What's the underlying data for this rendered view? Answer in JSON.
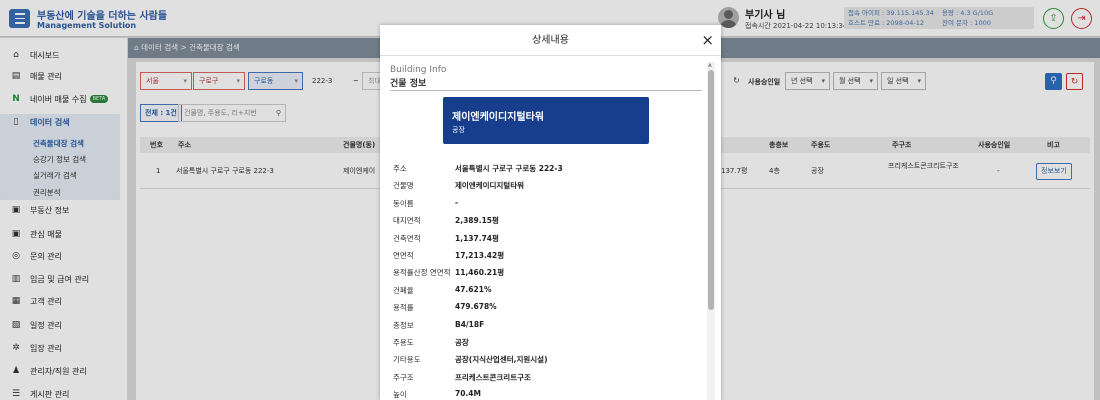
{
  "header": {
    "brand_title": "부동산에 기술을 더하는 사람들",
    "brand_subtitle": "Management Solution",
    "user_name": "부기사 님",
    "login_time": "접속시간 2021-04-22 10:13:34",
    "info": {
      "ip": "접속 아이피 : 39.115.145.34",
      "host_expiry": "호스트 만료 : 2098-04-12",
      "capacity": "용량 : 4.3 G/10G",
      "remaining_sms": "잔여 문자 : 1000"
    }
  },
  "sidebar": {
    "items": [
      {
        "label": "대시보드",
        "icon": "home-icon",
        "glyph": "⌂"
      },
      {
        "label": "매물 관리",
        "icon": "building-icon",
        "glyph": "▤"
      },
      {
        "label": "네이버 매물 수집",
        "icon": "naver-icon",
        "glyph": "N",
        "badge": "BETA"
      },
      {
        "label": "데이터 검색",
        "icon": "document-icon",
        "glyph": "▯"
      },
      {
        "label": "부동산 정보",
        "icon": "news-icon",
        "glyph": "▣"
      },
      {
        "label": "관심 매물",
        "icon": "star-box-icon",
        "glyph": "▣"
      },
      {
        "label": "문의 관리",
        "icon": "question-icon",
        "glyph": "◎"
      },
      {
        "label": "입금 및 급여 관리",
        "icon": "money-icon",
        "glyph": "▥"
      },
      {
        "label": "고객 관리",
        "icon": "people-icon",
        "glyph": "▦"
      },
      {
        "label": "일정 관리",
        "icon": "calendar-icon",
        "glyph": "▧"
      },
      {
        "label": "임장 관리",
        "icon": "tools-icon",
        "glyph": "✲"
      },
      {
        "label": "관리자/직원 관리",
        "icon": "user-gear-icon",
        "glyph": "♟"
      },
      {
        "label": "게시판 관리",
        "icon": "list-icon",
        "glyph": "☰"
      }
    ],
    "sub_items": [
      {
        "label": "건축물대장 검색"
      },
      {
        "label": "승강기 정보 검색"
      },
      {
        "label": "실거래가 검색"
      },
      {
        "label": "권리분석"
      }
    ]
  },
  "breadcrumb": "⌂ 데이터 검색 > 건축물대장 검색",
  "filters": {
    "city": "서울",
    "district": "구로구",
    "dong": "구로동",
    "lot": "222-3",
    "tilde": "~",
    "truncated": "최대",
    "approval_label": "사용승인일",
    "year_select": "년 선택",
    "month_select": "월 선택",
    "day_select": "일 선택",
    "total": "전체 : 1건",
    "search_placeholder": "건물명, 주용도, 리+지번"
  },
  "table": {
    "headers": [
      "번호",
      "주소",
      "건물명(동)",
      "총층보",
      "주용도",
      "주구조",
      "사용승인일",
      "비고"
    ],
    "row": {
      "no": "1",
      "address": "서울특별시 구로구 구로동 222-3",
      "name": "제이엔케이",
      "area": "137.7평",
      "floors": "4층",
      "use": "공장",
      "structure": "프리케스트콘크리트구조",
      "approval": "-",
      "action": "정보보기"
    }
  },
  "modal": {
    "title": "상세내용",
    "close": "×",
    "section_en": "Building Info",
    "section_ko": "건물 정보",
    "building_name": "제이엔케이디지털타워",
    "building_use": "공장",
    "details": [
      {
        "label": "주소",
        "value": "서울특별시 구로구 구로동 222-3"
      },
      {
        "label": "건물명",
        "value": "제이엔케이디지털타워"
      },
      {
        "label": "동이름",
        "value": "-"
      },
      {
        "label": "대지면적",
        "value": "2,389.15평"
      },
      {
        "label": "건축면적",
        "value": "1,137.74평"
      },
      {
        "label": "연면적",
        "value": "17,213.42평"
      },
      {
        "label": "용적률산정 연면적",
        "value": "11,460.21평"
      },
      {
        "label": "건폐율",
        "value": "47.621%"
      },
      {
        "label": "용적률",
        "value": "479.678%"
      },
      {
        "label": "층정보",
        "value": "B4/18F"
      },
      {
        "label": "주용도",
        "value": "공장"
      },
      {
        "label": "기타용도",
        "value": "공장(지식산업센터,지원시설)"
      },
      {
        "label": "주구조",
        "value": "프리케스트콘크리트구조"
      },
      {
        "label": "높이",
        "value": "70.4M"
      }
    ]
  }
}
